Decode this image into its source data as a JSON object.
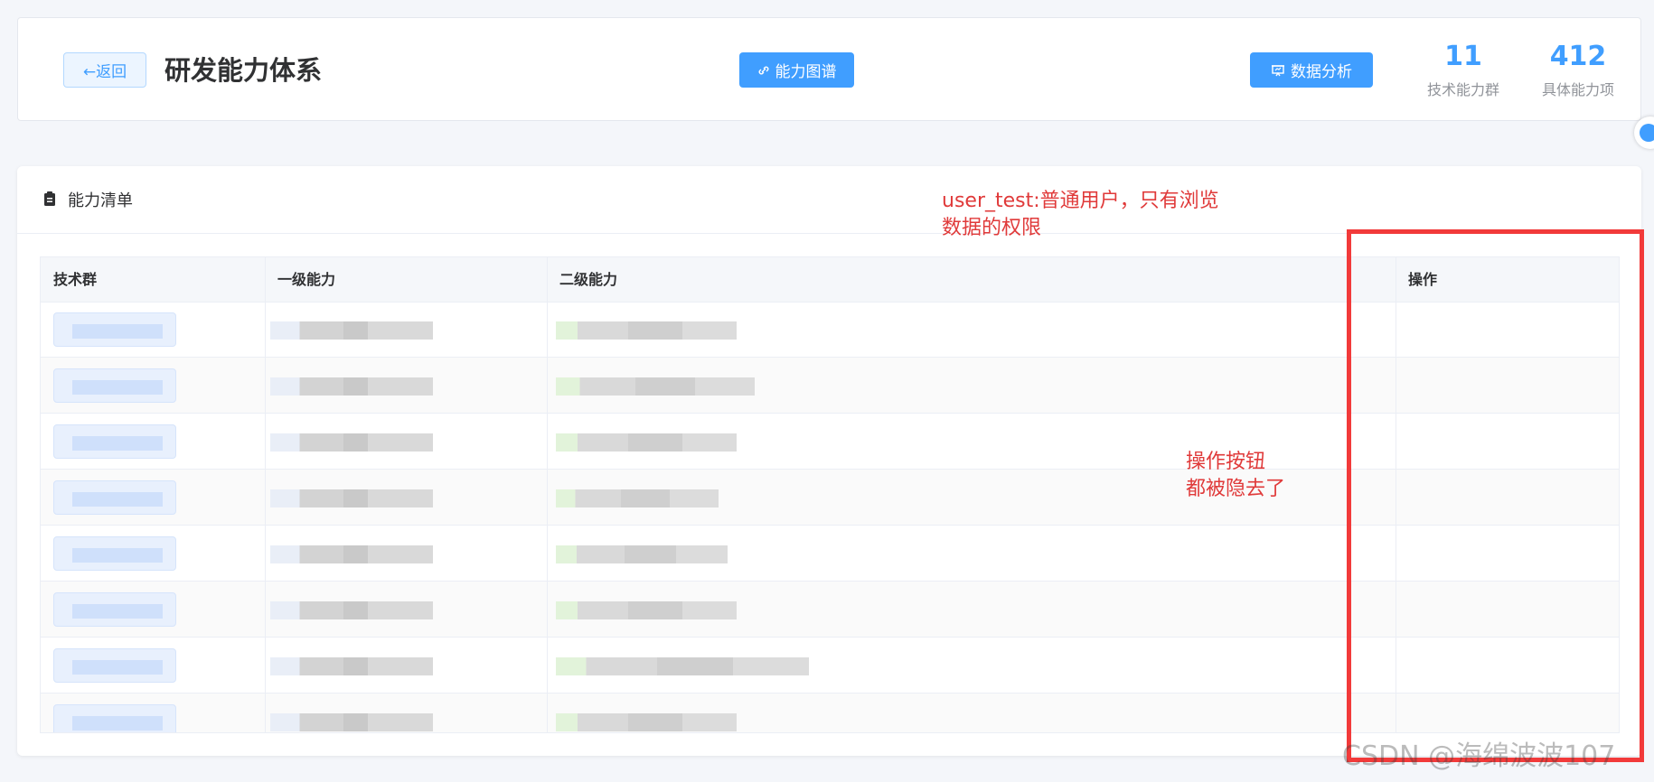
{
  "header": {
    "back_label": "←返回",
    "title": "研发能力体系",
    "map_button_label": "能力图谱",
    "analysis_button_label": "数据分析",
    "stats": [
      {
        "value": "11",
        "label": "技术能力群"
      },
      {
        "value": "412",
        "label": "具体能力项"
      }
    ]
  },
  "list": {
    "title": "能力清单",
    "columns": [
      "技术群",
      "一级能力",
      "二级能力",
      "操作"
    ],
    "row_count": 8
  },
  "annotations": {
    "user_note_line1": "user_test:普通用户，只有浏览",
    "user_note_line2": "数据的权限",
    "ops_note_line1": "操作按钮",
    "ops_note_line2": "都被隐去了"
  },
  "watermark": "CSDN @海绵波波107",
  "colors": {
    "primary": "#409eff",
    "annotation_red": "#f23a3a"
  }
}
